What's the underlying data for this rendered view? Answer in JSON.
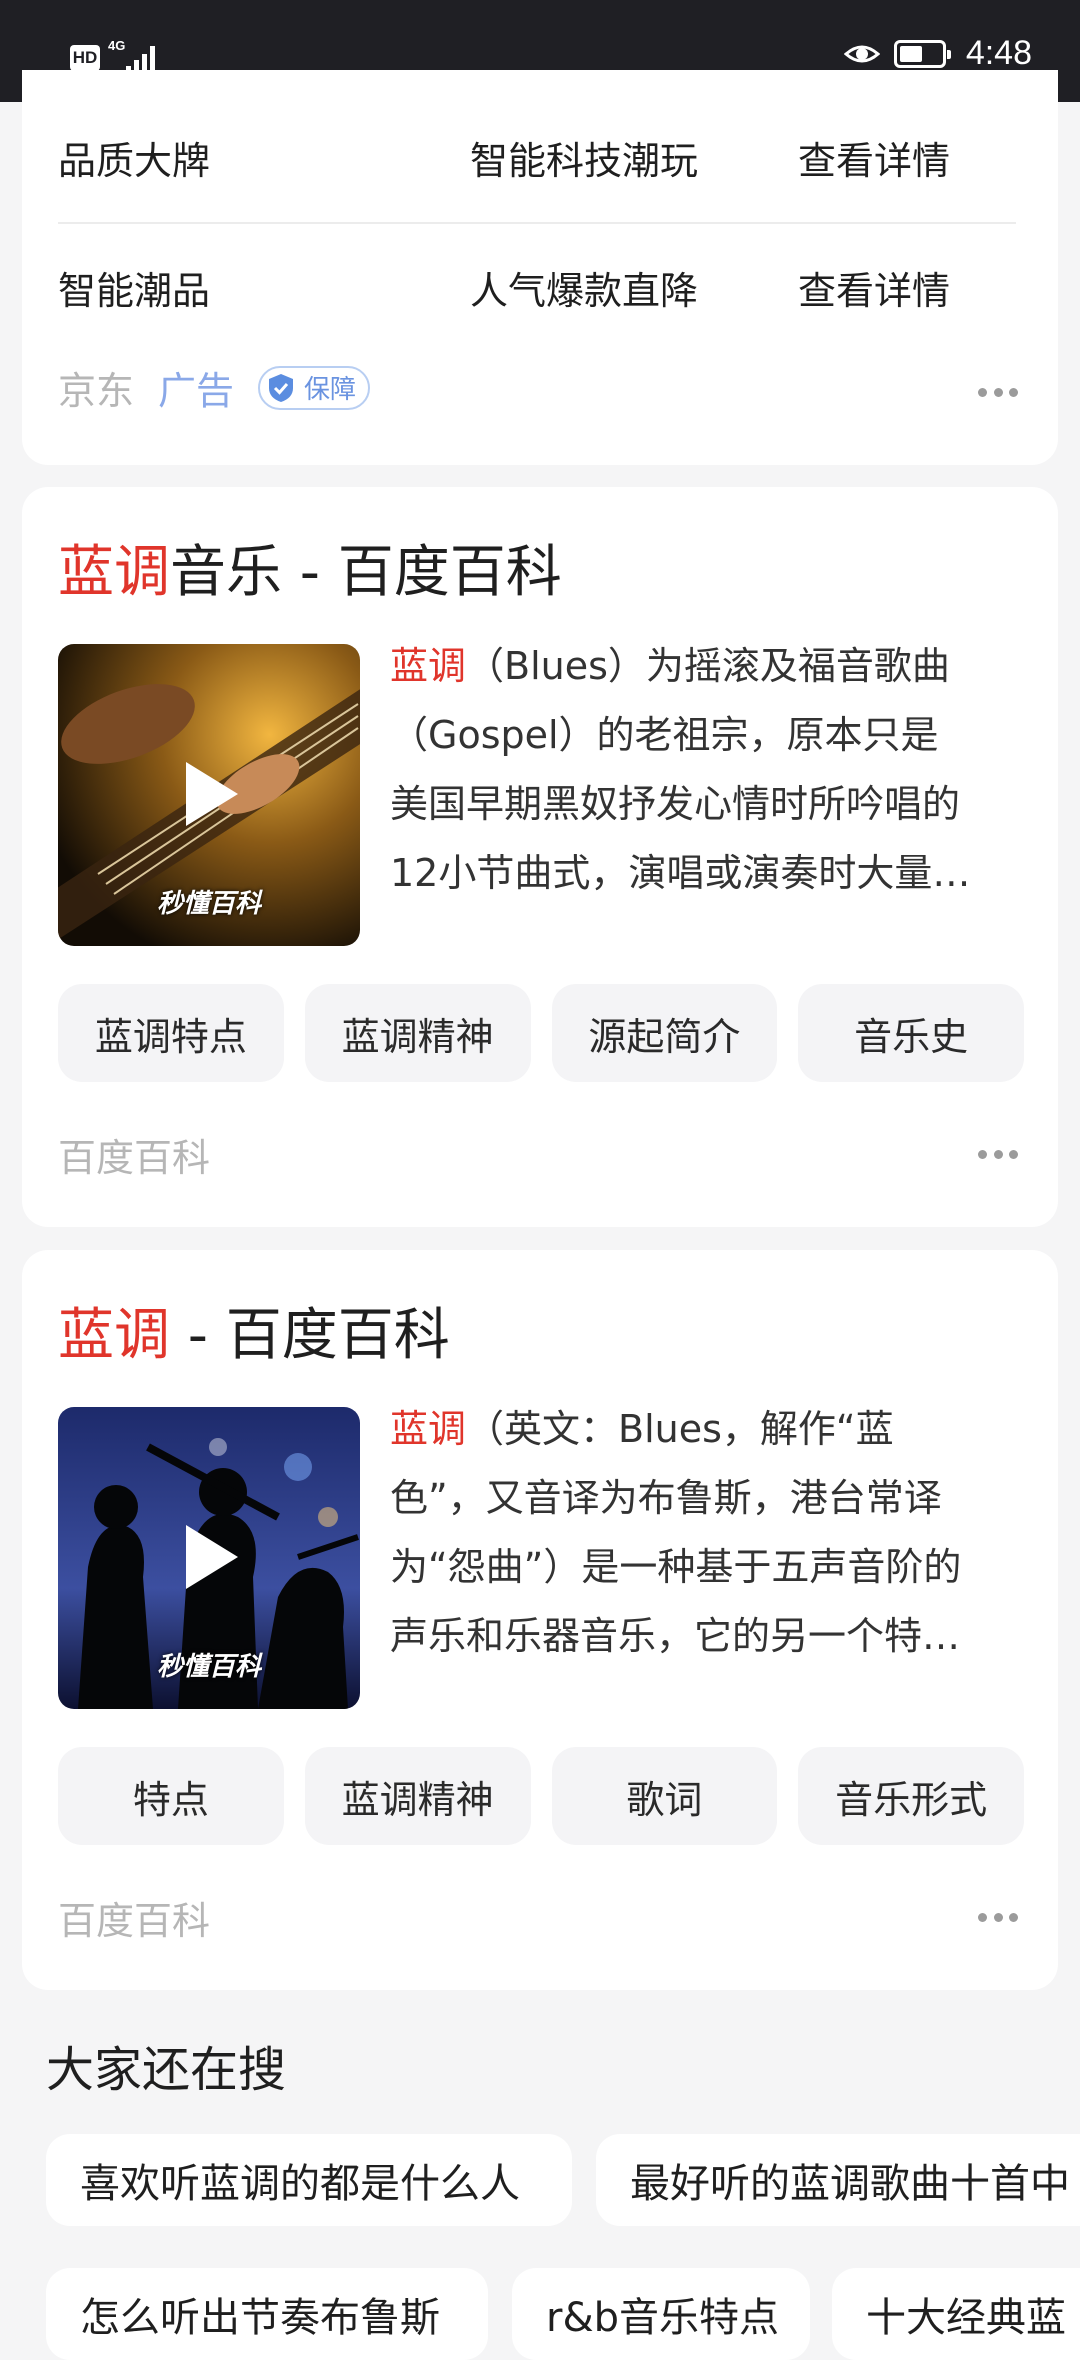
{
  "status_bar": {
    "hd": "HD",
    "network": "4G",
    "time": "4:48",
    "battery_level": 0.55
  },
  "ad_card": {
    "rows": [
      {
        "col1": "品质大牌",
        "col2": "智能科技潮玩",
        "col3": "查看详情"
      },
      {
        "col1": "智能潮品",
        "col2": "人气爆款直降",
        "col3": "查看详情"
      }
    ],
    "source": "京东",
    "ad_label": "广告",
    "guarantee_badge": "保障"
  },
  "results": [
    {
      "title_highlight": "蓝调",
      "title_rest": "音乐 - 百度百科",
      "desc_highlight": "蓝调",
      "desc_lines": [
        "（Blues）为摇滚及福音歌曲",
        "（Gospel）的老祖宗，原本只是",
        "美国早期黑奴抒发心情时所吟唱的",
        "12小节曲式，演唱或演奏时大量…"
      ],
      "thumb_watermark": "秒懂百科",
      "chips": [
        "蓝调特点",
        "蓝调精神",
        "源起简介",
        "音乐史"
      ],
      "source": "百度百科"
    },
    {
      "title_highlight": "蓝调",
      "title_rest": " - 百度百科",
      "desc_highlight": "蓝调",
      "desc_lines": [
        "（英文：Blues，解作“蓝",
        "色”，又音译为布鲁斯，港台常译",
        "为“怨曲”）是一种基于五声音阶的",
        "声乐和乐器音乐，它的另一个特…"
      ],
      "thumb_watermark": "秒懂百科",
      "chips": [
        "特点",
        "蓝调精神",
        "歌词",
        "音乐形式"
      ],
      "source": "百度百科"
    }
  ],
  "also_search": {
    "title": "大家还在搜",
    "tags": [
      "喜欢听蓝调的都是什么人",
      "最好听的蓝调歌曲十首中",
      "怎么听出节奏布鲁斯",
      "r&b音乐特点",
      "十大经典蓝"
    ]
  },
  "colors": {
    "highlight": "#e0352b",
    "ad_blue": "#8aa8e8",
    "status_bg": "#1f1f24",
    "page_bg": "#f5f5f6"
  }
}
